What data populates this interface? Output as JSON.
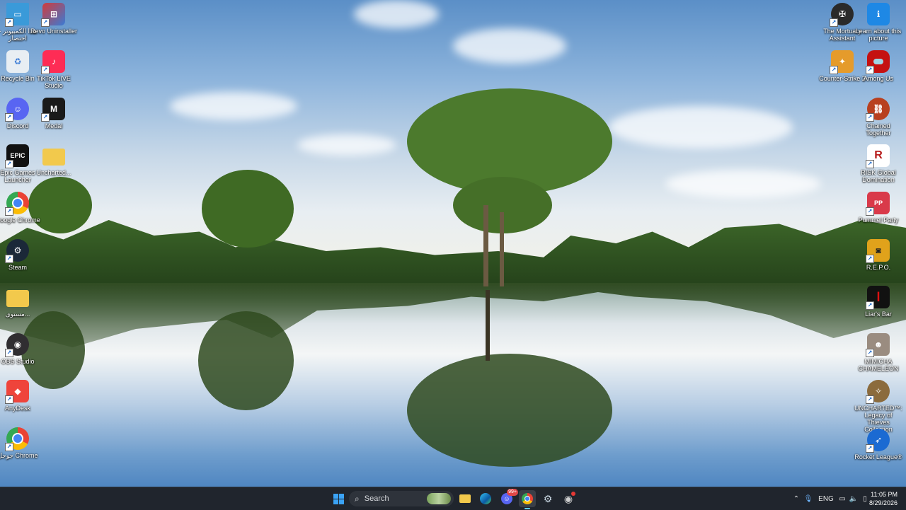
{
  "desktop_icons_left": [
    {
      "label": "هذا الكمبيوتر - اختصار",
      "icon": "this-pc-icon",
      "color": "#3a9ad9"
    },
    {
      "label": "Revo Uninstaller",
      "icon": "revo-uninstaller-icon",
      "color": "#d23b3b"
    },
    {
      "label": "Recycle Bin",
      "icon": "recycle-bin-icon",
      "color": "#cfd8e0"
    },
    {
      "label": "TikTok LIVE Studio",
      "icon": "tiktok-live-studio-icon",
      "color": "#fe2c55"
    },
    {
      "label": "Discord",
      "icon": "discord-icon",
      "color": "#5865f2"
    },
    {
      "label": "Medal",
      "icon": "medal-icon",
      "color": "#1a1a1a"
    },
    {
      "label": "Epic Games Launcher",
      "icon": "epic-games-icon",
      "color": "#111111"
    },
    {
      "label": "Uncharted...",
      "icon": "folder-icon",
      "color": "#f2c94c"
    },
    {
      "label": "Google Chrome",
      "icon": "chrome-icon",
      "color": "#4285f4"
    },
    {
      "label": "Steam",
      "icon": "steam-icon",
      "color": "#1b2838"
    },
    {
      "label": "مستوى...",
      "icon": "folder-icon",
      "color": "#f2c94c"
    },
    {
      "label": "OBS Studio",
      "icon": "obs-icon",
      "color": "#302e31"
    },
    {
      "label": "AnyDesk",
      "icon": "anydesk-icon",
      "color": "#ef443b"
    },
    {
      "label": "جوجل Chrome",
      "icon": "chrome-icon",
      "color": "#4285f4"
    }
  ],
  "desktop_icons_right": [
    {
      "label": "The Mortuary Assistant",
      "icon": "mortuary-assistant-icon",
      "color": "#2a2a2a"
    },
    {
      "label": "Learn about this picture",
      "icon": "info-icon",
      "color": "#1e88e5"
    },
    {
      "label": "Counter-Strike 2",
      "icon": "counter-strike-icon",
      "color": "#e59b2b"
    },
    {
      "label": "Among Us",
      "icon": "among-us-icon",
      "color": "#c51111"
    },
    {
      "label": "Chained Together",
      "icon": "chained-together-icon",
      "color": "#b8401f"
    },
    {
      "label": "RISK Global Domination",
      "icon": "risk-icon",
      "color": "#b71c1c"
    },
    {
      "label": "Pummel Party",
      "icon": "pummel-party-icon",
      "color": "#d93a4a"
    },
    {
      "label": "R.E.P.O.",
      "icon": "repo-icon",
      "color": "#e0a21b"
    },
    {
      "label": "Liar's Bar",
      "icon": "liars-bar-icon",
      "color": "#111111"
    },
    {
      "label": "MIMICHA CHAMELEON",
      "icon": "mimicha-icon",
      "color": "#9a8c80"
    },
    {
      "label": "UNCHARTED™: Legacy of Thieves Collection",
      "icon": "uncharted-icon",
      "color": "#8b6b3d"
    },
    {
      "label": "Rocket League®",
      "icon": "rocket-league-icon",
      "color": "#1b6ad2"
    }
  ],
  "taskbar": {
    "search_placeholder": "Search",
    "apps": [
      {
        "name": "start-button",
        "icon": "windows-icon",
        "color": "#3ba3f5"
      },
      {
        "name": "file-explorer",
        "icon": "folder-icon",
        "color": "#f2c94c"
      },
      {
        "name": "edge",
        "icon": "edge-icon",
        "color": "#2e9edb"
      },
      {
        "name": "discord",
        "icon": "discord-icon",
        "color": "#5865f2",
        "badge": "99+"
      },
      {
        "name": "chrome",
        "icon": "chrome-icon",
        "color": "#4285f4"
      },
      {
        "name": "steam",
        "icon": "steam-icon",
        "color": "#c7d5e0"
      },
      {
        "name": "obs",
        "icon": "obs-icon",
        "color": "#cfcfcf"
      }
    ],
    "tray": {
      "language": "ENG",
      "time": "11:05 PM",
      "date": "8/29/2026"
    }
  }
}
